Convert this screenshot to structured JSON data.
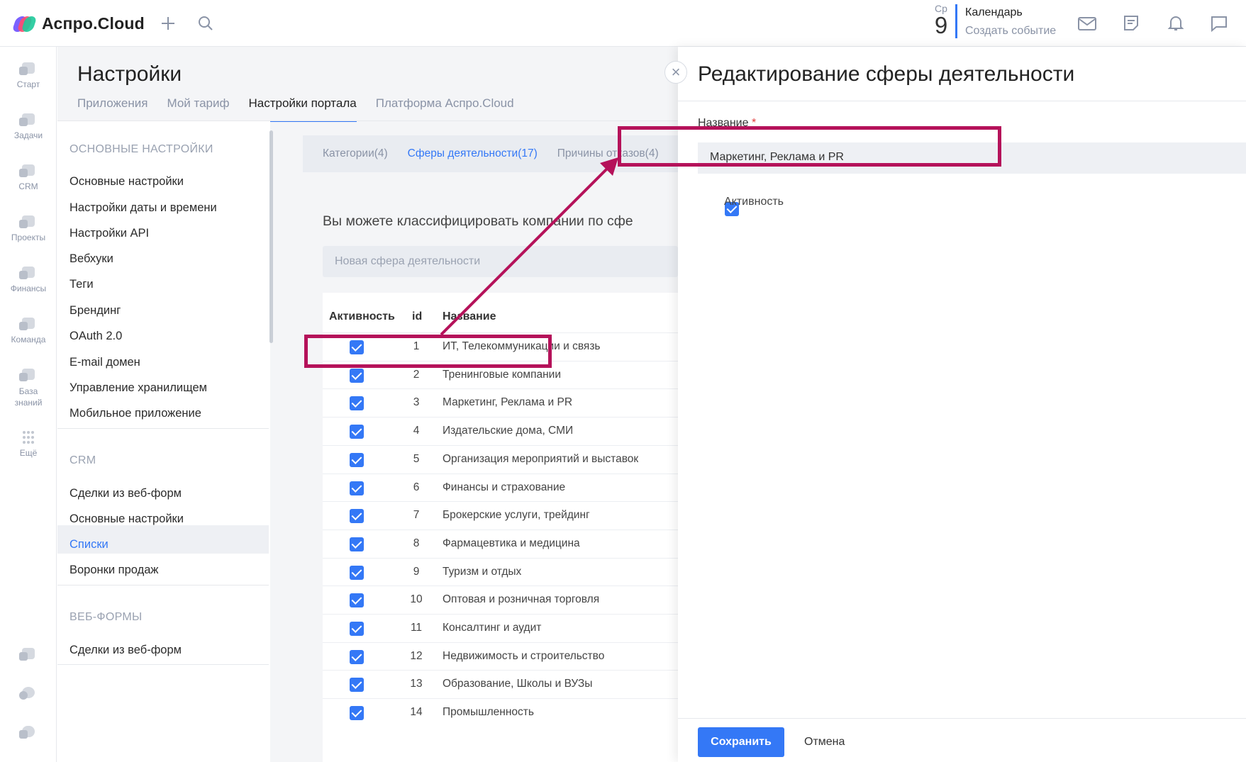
{
  "app": {
    "logo_text": "Аспро.Cloud"
  },
  "calendar": {
    "day_of_week": "Ср",
    "day_number": "9",
    "title": "Календарь",
    "create_label": "Создать событие"
  },
  "rail": [
    "Старт",
    "Задачи",
    "CRM",
    "Проекты",
    "Финансы",
    "Команда",
    "База знаний",
    "Ещё"
  ],
  "settings": {
    "title": "Настройки",
    "tabs": [
      "Приложения",
      "Мой тариф",
      "Настройки портала",
      "Платформа Аспро.Cloud"
    ],
    "active_tab": "Настройки портала",
    "menu": {
      "section_main": "ОСНОВНЫЕ НАСТРОЙКИ",
      "main_items": [
        "Основные настройки",
        "Настройки даты и времени",
        "Настройки API",
        "Вебхуки",
        "Теги",
        "Брендинг",
        "OAuth 2.0",
        "E-mail домен",
        "Управление хранилищем",
        "Мобильное приложение"
      ],
      "section_crm": "CRM",
      "crm_items": [
        "Сделки из веб-форм",
        "Основные настройки",
        "Списки",
        "Воронки продаж"
      ],
      "active_item": "Списки",
      "section_webforms": "ВЕБ-ФОРМЫ",
      "webforms_items": [
        "Сделки из веб-форм"
      ]
    },
    "content": {
      "tabs": [
        "Категории(4)",
        "Сферы деятельности(17)",
        "Причины отказов(4)"
      ],
      "active_tab": "Сферы деятельности(17)",
      "description": "Вы можете классифицировать компании по сфе",
      "new_placeholder": "Новая сфера деятельности",
      "columns": {
        "active": "Активность",
        "id": "id",
        "name": "Название"
      },
      "rows": [
        {
          "id": "1",
          "name": "ИТ, Телекоммуникации и связь",
          "active": true
        },
        {
          "id": "2",
          "name": "Тренинговые компании",
          "active": true
        },
        {
          "id": "3",
          "name": "Маркетинг, Реклама и PR",
          "active": true
        },
        {
          "id": "4",
          "name": "Издательские дома, СМИ",
          "active": true
        },
        {
          "id": "5",
          "name": "Организация мероприятий и выставок",
          "active": true
        },
        {
          "id": "6",
          "name": "Финансы и страхование",
          "active": true
        },
        {
          "id": "7",
          "name": "Брокерские услуги, трейдинг",
          "active": true
        },
        {
          "id": "8",
          "name": "Фармацевтика и медицина",
          "active": true
        },
        {
          "id": "9",
          "name": "Туризм и отдых",
          "active": true
        },
        {
          "id": "10",
          "name": "Оптовая и розничная торговля",
          "active": true
        },
        {
          "id": "11",
          "name": "Консалтинг и аудит",
          "active": true
        },
        {
          "id": "12",
          "name": "Недвижимость и строительство",
          "active": true
        },
        {
          "id": "13",
          "name": "Образование, Школы и ВУЗы",
          "active": true
        },
        {
          "id": "14",
          "name": "Промышленность",
          "active": true
        }
      ]
    }
  },
  "edit_panel": {
    "title": "Редактирование сферы деятельности",
    "name_label": "Название",
    "required_mark": "*",
    "name_value": "Маркетинг, Реклама и PR",
    "active_label": "Активность",
    "active_checked": true,
    "save_label": "Сохранить",
    "cancel_label": "Отмена",
    "close_glyph": "×"
  },
  "colors": {
    "accent": "#3478f6",
    "annotation": "#b5125a",
    "required": "#e23b3b"
  }
}
